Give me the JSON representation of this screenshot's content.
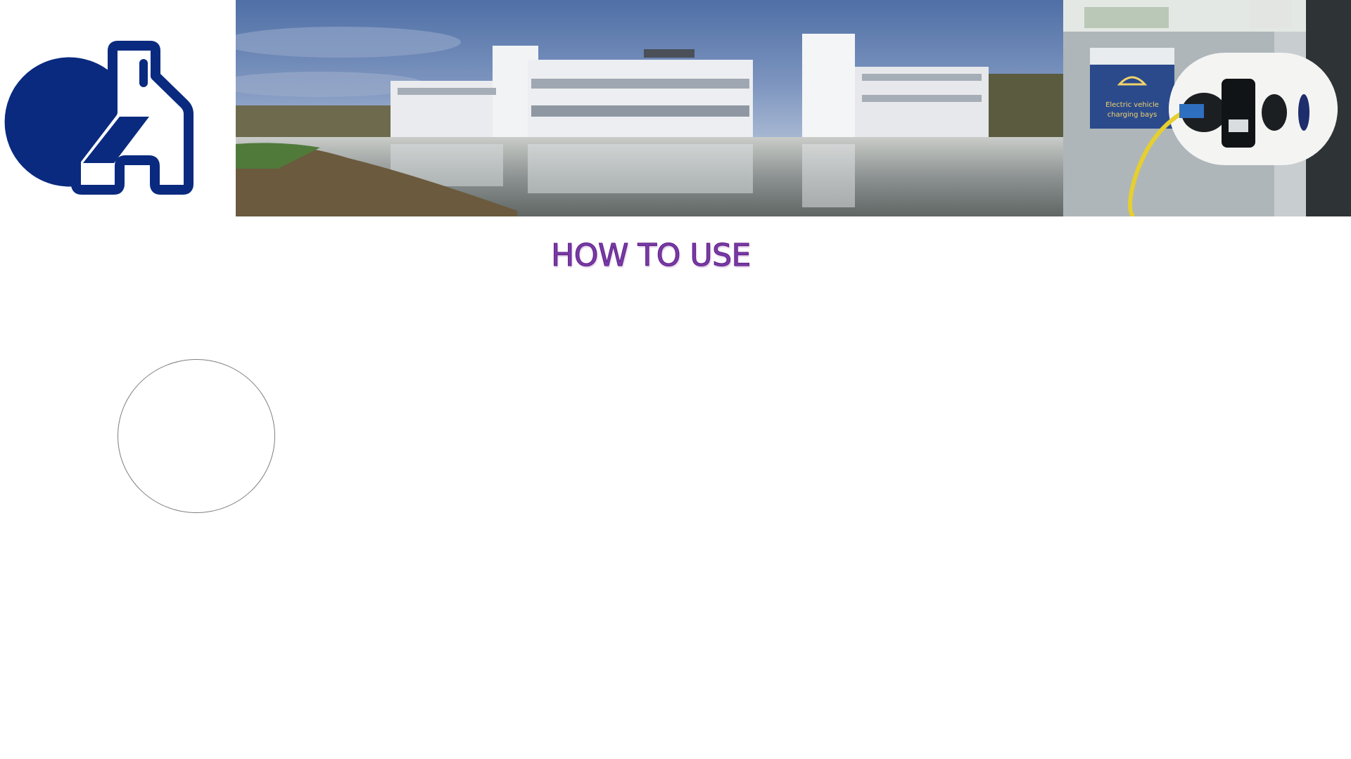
{
  "page": {
    "heading": "HOW TO USE"
  },
  "banner": {
    "logo": {
      "icon": "brand-logo-icon",
      "color": "#0a2a7f"
    },
    "building_photo": {
      "icon": "office-building-lake-photo"
    },
    "charger_photo": {
      "icon": "ev-charger-photo",
      "sign_text": "Electric vehicle charging bays"
    }
  },
  "colors": {
    "heading": "#7a3aa6",
    "logo_blue": "#0a2a7f"
  }
}
